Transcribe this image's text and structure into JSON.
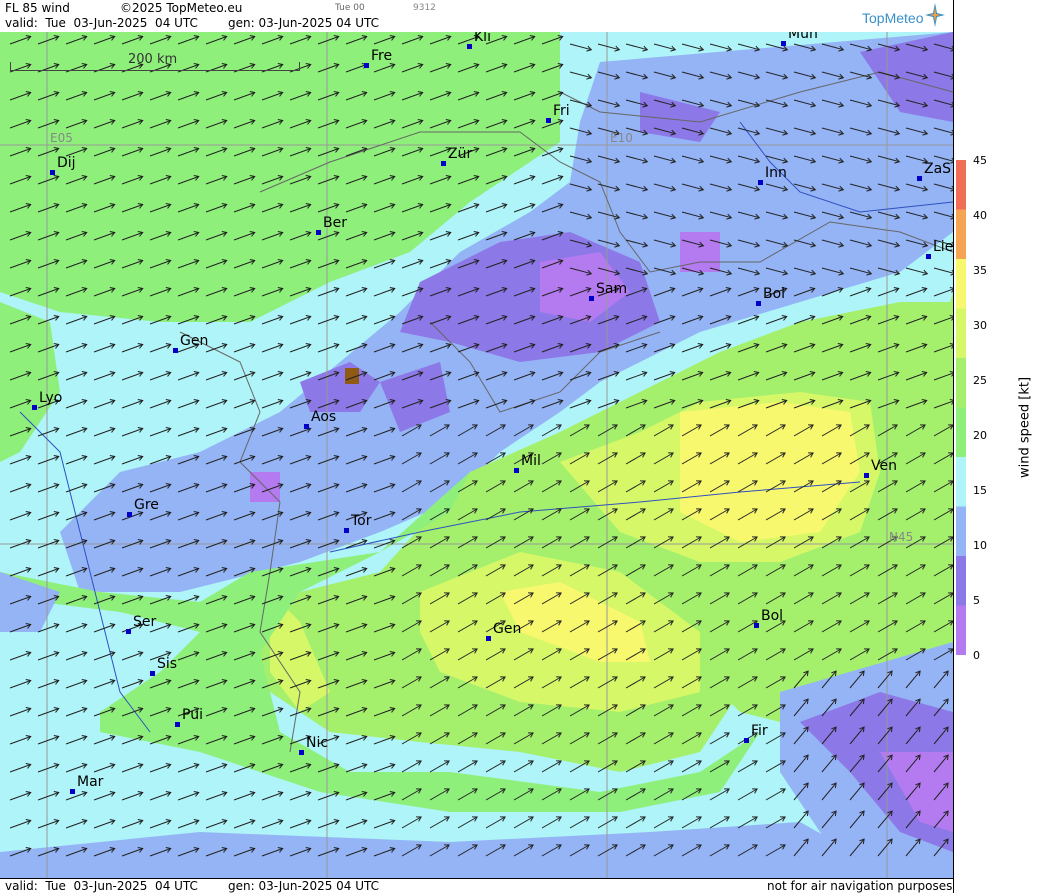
{
  "header": {
    "product": "FL 85 wind",
    "copyright": "©2025 TopMeteo.eu",
    "valid_label": "valid:  Tue  03-Jun-2025  04 UTC",
    "gen_label": "gen: 03-Jun-2025 04 UTC",
    "run": "Tue 00",
    "code": "9312",
    "logo": "TopMeteo"
  },
  "footer": {
    "valid_label": "valid:  Tue  03-Jun-2025  04 UTC",
    "gen_label": "gen: 03-Jun-2025 04 UTC",
    "disclaimer": "not for air navigation purposes"
  },
  "map": {
    "scale_label": "200 km",
    "grid_labels": {
      "e05": "E05",
      "e10": "E10",
      "n45": "N45"
    },
    "cities": [
      {
        "name": "Kli"
      },
      {
        "name": "Mün"
      },
      {
        "name": "Fre"
      },
      {
        "name": "Fri"
      },
      {
        "name": "Dij"
      },
      {
        "name": "Zür"
      },
      {
        "name": "Inn"
      },
      {
        "name": "ZaS"
      },
      {
        "name": "Ber"
      },
      {
        "name": "Lie"
      },
      {
        "name": "Sam"
      },
      {
        "name": "Bol"
      },
      {
        "name": "Gen"
      },
      {
        "name": "Lyo"
      },
      {
        "name": "Aos"
      },
      {
        "name": "Mil"
      },
      {
        "name": "Ven"
      },
      {
        "name": "Gre"
      },
      {
        "name": "Tor"
      },
      {
        "name": "Ser"
      },
      {
        "name": "Gen"
      },
      {
        "name": "Bol"
      },
      {
        "name": "Sis"
      },
      {
        "name": "Pui"
      },
      {
        "name": "Nic"
      },
      {
        "name": "Fir"
      },
      {
        "name": "Mar"
      }
    ]
  },
  "legend": {
    "title": "wind speed [kt]",
    "ticks": [
      "45",
      "40",
      "35",
      "30",
      "25",
      "20",
      "15",
      "10",
      "5",
      "0"
    ],
    "colors": [
      "#b47af0",
      "#8c78e6",
      "#94b4f6",
      "#aef4f8",
      "#8ef07a",
      "#a4f06c",
      "#d6f868",
      "#f8f86e",
      "#f4a452",
      "#f06e56"
    ]
  }
}
